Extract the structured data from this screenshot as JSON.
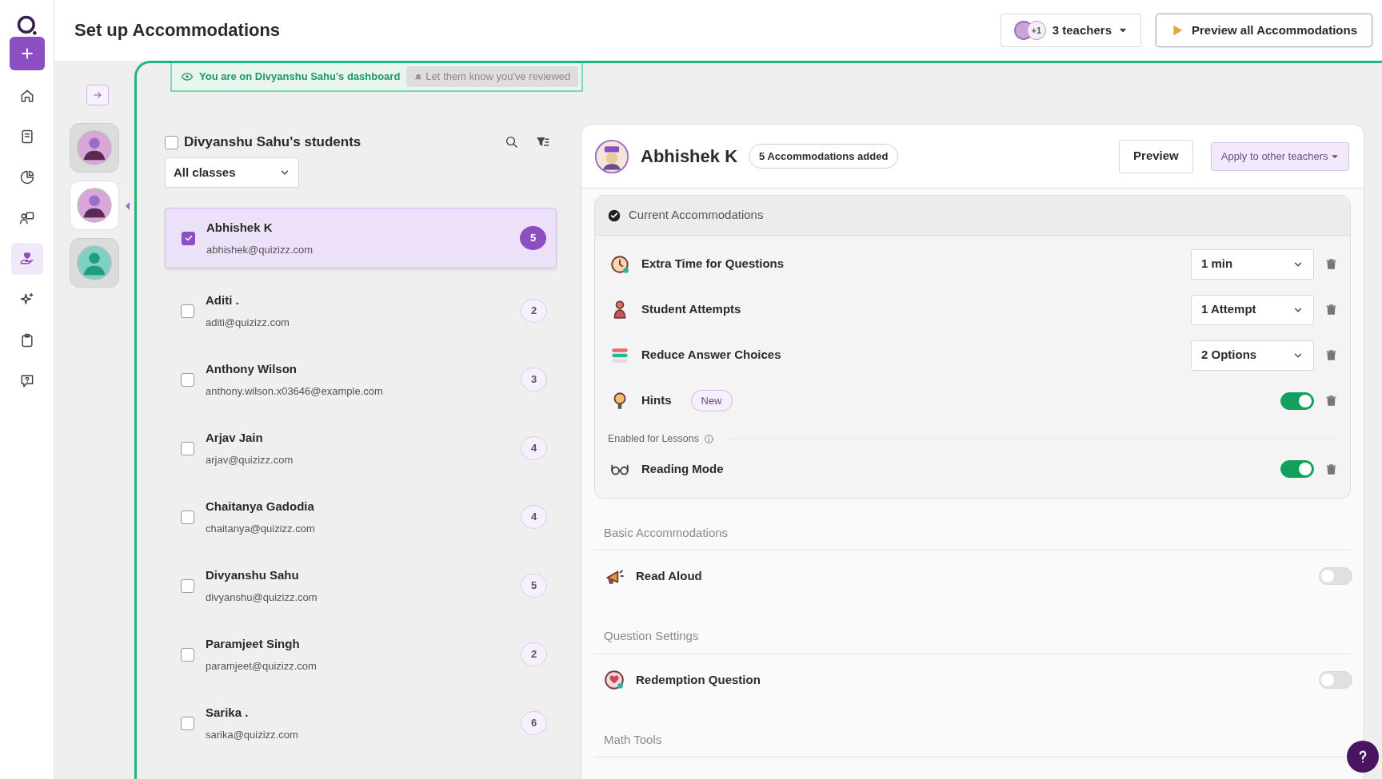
{
  "app": {
    "title": "Set up Accommodations"
  },
  "sidebar": {
    "items": [
      {
        "kind": "home",
        "selected": false
      },
      {
        "kind": "book",
        "selected": false
      },
      {
        "kind": "chart",
        "selected": false
      },
      {
        "kind": "presenter",
        "selected": false
      },
      {
        "kind": "care",
        "selected": true
      },
      {
        "kind": "sparkle",
        "selected": false
      },
      {
        "kind": "clipboard",
        "selected": false
      },
      {
        "kind": "help",
        "selected": false
      }
    ]
  },
  "teachers_button": {
    "extra": "+1",
    "label": "3 teachers"
  },
  "preview_all_button": "Preview all Accommodations",
  "teacher_avatars": [
    {
      "selected": false,
      "color": "#d9a6d9"
    },
    {
      "selected": true,
      "color": "#d9a6d9"
    },
    {
      "selected": false,
      "color": "#7fd1c4"
    }
  ],
  "banner": {
    "text": "You are on Divyanshu Sahu's dashboard",
    "button": "Let them know you've reviewed"
  },
  "students": {
    "title": "Divyanshu Sahu's students",
    "select_all_checked": false,
    "class_filter": "All classes",
    "rows": [
      {
        "name": "Abhishek K",
        "email": "abhishek@quizizz.com",
        "count": "5",
        "selected": true
      },
      {
        "name": "Aditi .",
        "email": "aditi@quizizz.com",
        "count": "2",
        "selected": false
      },
      {
        "name": "Anthony Wilson",
        "email": "anthony.wilson.x03646@example.com",
        "count": "3",
        "selected": false
      },
      {
        "name": "Arjav Jain",
        "email": "arjav@quizizz.com",
        "count": "4",
        "selected": false
      },
      {
        "name": "Chaitanya Gadodia",
        "email": "chaitanya@quizizz.com",
        "count": "4",
        "selected": false
      },
      {
        "name": "Divyanshu Sahu",
        "email": "divyanshu@quizizz.com",
        "count": "5",
        "selected": false
      },
      {
        "name": "Paramjeet Singh",
        "email": "paramjeet@quizizz.com",
        "count": "2",
        "selected": false
      },
      {
        "name": "Sarika .",
        "email": "sarika@quizizz.com",
        "count": "6",
        "selected": false
      }
    ]
  },
  "detail": {
    "name": "Abhishek K",
    "badge": "5 Accommodations added",
    "preview_button": "Preview",
    "apply_button": "Apply to other teachers",
    "current": {
      "title": "Current Accommodations",
      "items": [
        {
          "kind": "dropdown",
          "label": "Extra Time for Questions",
          "value": "1 min"
        },
        {
          "kind": "dropdown",
          "label": "Student Attempts",
          "value": "1 Attempt"
        },
        {
          "kind": "dropdown",
          "label": "Reduce Answer Choices",
          "value": "2 Options"
        },
        {
          "kind": "toggle",
          "label": "Hints",
          "tag": "New",
          "on": true
        }
      ],
      "lessons_label": "Enabled for Lessons",
      "lesson_items": [
        {
          "kind": "toggle",
          "label": "Reading Mode",
          "on": true
        }
      ]
    },
    "sections": [
      {
        "title": "Basic Accommodations",
        "items": [
          {
            "kind": "toggle",
            "label": "Read Aloud",
            "on": false
          }
        ]
      },
      {
        "title": "Question Settings",
        "items": [
          {
            "kind": "toggle",
            "label": "Redemption Question",
            "on": false
          }
        ]
      },
      {
        "title": "Math Tools"
      }
    ]
  }
}
